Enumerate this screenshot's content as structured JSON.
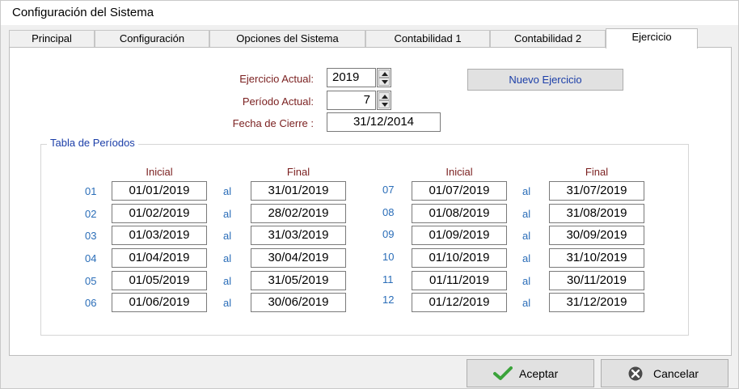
{
  "window": {
    "title": "Configuración del Sistema"
  },
  "tabs": [
    {
      "label": "Principal"
    },
    {
      "label": "Configuración"
    },
    {
      "label": "Opciones del Sistema"
    },
    {
      "label": "Contabilidad 1"
    },
    {
      "label": "Contabilidad 2"
    },
    {
      "label": "Ejercicio",
      "active": true
    }
  ],
  "form": {
    "ejercicio_label": "Ejercicio Actual:",
    "ejercicio_value": "2019",
    "periodo_label": "Período Actual:",
    "periodo_value": "7",
    "fecha_cierre_label": "Fecha de Cierre :",
    "fecha_cierre_value": "31/12/2014",
    "nuevo_button": "Nuevo Ejercicio"
  },
  "periods": {
    "group_title": "Tabla de Períodos",
    "header_start": "Inicial",
    "header_end": "Final",
    "separator": "al",
    "rows": [
      {
        "num": "01",
        "start": "01/01/2019",
        "end": "31/01/2019"
      },
      {
        "num": "02",
        "start": "01/02/2019",
        "end": "28/02/2019"
      },
      {
        "num": "03",
        "start": "01/03/2019",
        "end": "31/03/2019"
      },
      {
        "num": "04",
        "start": "01/04/2019",
        "end": "30/04/2019"
      },
      {
        "num": "05",
        "start": "01/05/2019",
        "end": "31/05/2019"
      },
      {
        "num": "06",
        "start": "01/06/2019",
        "end": "30/06/2019"
      },
      {
        "num": "07",
        "start": "01/07/2019",
        "end": "31/07/2019"
      },
      {
        "num": "08",
        "start": "01/08/2019",
        "end": "31/08/2019"
      },
      {
        "num": "09",
        "start": "01/09/2019",
        "end": "30/09/2019"
      },
      {
        "num": "10",
        "start": "01/10/2019",
        "end": "31/10/2019"
      },
      {
        "num": "11",
        "start": "01/11/2019",
        "end": "30/11/2019"
      },
      {
        "num": "12",
        "start": "01/12/2019",
        "end": "31/12/2019"
      }
    ]
  },
  "footer": {
    "accept_label": "Aceptar",
    "cancel_label": "Cancelar"
  },
  "icons": {
    "accept": "checkmark-icon",
    "cancel": "cancel-x-icon",
    "spinner_up": "arrow-up-icon",
    "spinner_down": "arrow-down-icon"
  },
  "colors": {
    "label_text": "#7a1f1f",
    "link_blue": "#1b3ea8",
    "number_blue": "#2a6db8",
    "accept_green": "#3aa33a"
  }
}
